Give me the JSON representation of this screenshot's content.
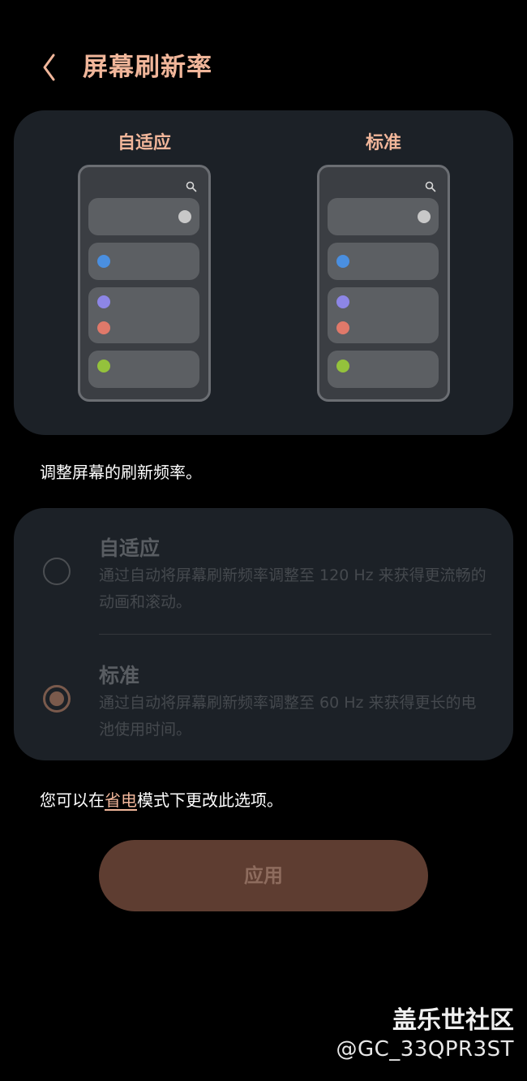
{
  "header": {
    "title": "屏幕刷新率"
  },
  "preview": {
    "left_label": "自适应",
    "right_label": "标准",
    "dot_colors": {
      "gray": "#c8c8c8",
      "blue": "#4a8fe0",
      "purple": "#8d86e6",
      "red": "#e0796a",
      "green": "#94c23c"
    }
  },
  "description": "调整屏幕的刷新频率。",
  "options": [
    {
      "title": "自适应",
      "description": "通过自动将屏幕刷新频率调整至 120 Hz 来获得更流畅的动画和滚动。",
      "selected": false
    },
    {
      "title": "标准",
      "description": "通过自动将屏幕刷新频率调整至 60 Hz 来获得更长的电池使用时间。",
      "selected": true
    }
  ],
  "note": {
    "prefix": "您可以在",
    "link": "省电",
    "suffix": "模式下更改此选项。"
  },
  "apply_button": {
    "label": "应用"
  },
  "watermark": {
    "brand": "盖乐世社区",
    "user": "@GC_33QPR3ST"
  },
  "colors": {
    "accent": "#f1b69a",
    "card_bg": "#1c2127",
    "button_bg": "#5e3d31"
  }
}
